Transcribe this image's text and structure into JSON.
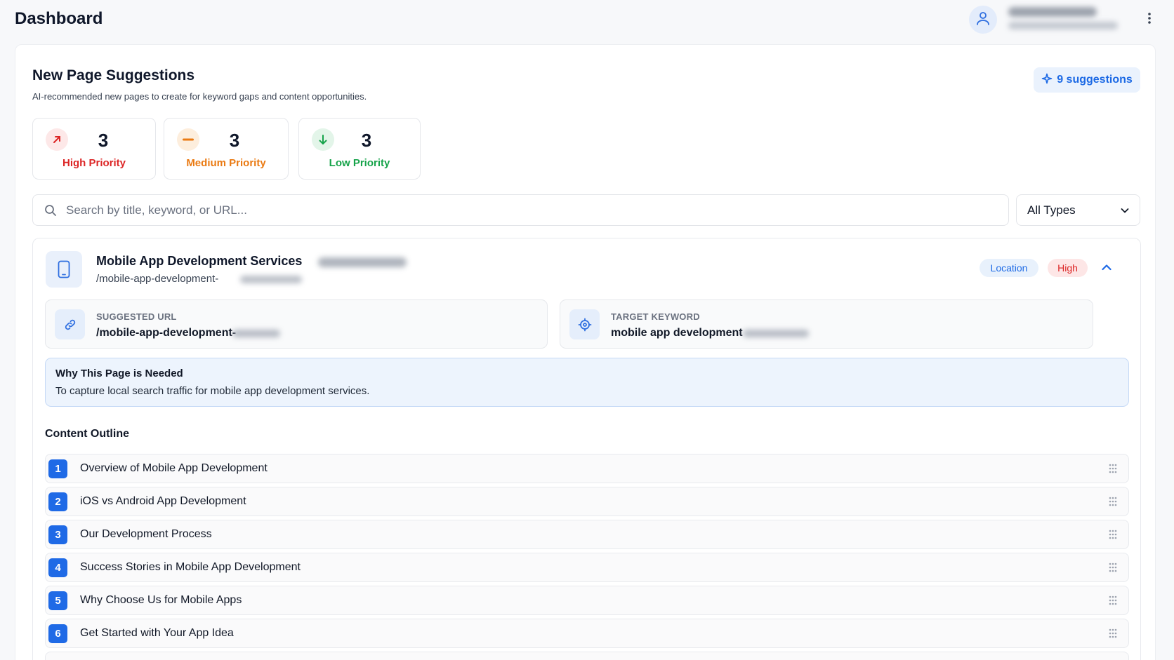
{
  "header": {
    "title": "Dashboard"
  },
  "section": {
    "title": "New Page Suggestions",
    "subtitle": "AI-recommended new pages to create for keyword gaps and content opportunities.",
    "suggestions_badge": "9 suggestions"
  },
  "stats": [
    {
      "count": "3",
      "label": "High Priority",
      "color": "#dc2626",
      "bg": "#fde8e8",
      "icon": "arrow-up-right-icon"
    },
    {
      "count": "3",
      "label": "Medium Priority",
      "color": "#ea7a12",
      "bg": "#fdeedd",
      "icon": "minus-icon"
    },
    {
      "count": "3",
      "label": "Low Priority",
      "color": "#16a34a",
      "bg": "#e3f5e9",
      "icon": "arrow-down-icon"
    }
  ],
  "filters": {
    "search_placeholder": "Search by title, keyword, or URL...",
    "type_value": "All Types"
  },
  "suggestion": {
    "title": "Mobile App Development Services",
    "url": "/mobile-app-development-",
    "type_badge": "Location",
    "priority_badge": "High",
    "suggested_url_label": "SUGGESTED URL",
    "suggested_url_value": "/mobile-app-development-",
    "target_keyword_label": "TARGET KEYWORD",
    "target_keyword_value": "mobile app development",
    "why_title": "Why This Page is Needed",
    "why_text": "To capture local search traffic for mobile app development services.",
    "outline_title": "Content Outline",
    "outline": [
      {
        "n": "1",
        "text": "Overview of Mobile App Development"
      },
      {
        "n": "2",
        "text": "iOS vs Android App Development"
      },
      {
        "n": "3",
        "text": "Our Development Process"
      },
      {
        "n": "4",
        "text": "Success Stories in Mobile App Development"
      },
      {
        "n": "5",
        "text": "Why Choose Us for Mobile Apps"
      },
      {
        "n": "6",
        "text": "Get Started with Your App Idea"
      }
    ]
  },
  "colors": {
    "accent": "#1f6ae6",
    "high": "#dc2626",
    "medium": "#ea7a12",
    "low": "#16a34a"
  }
}
